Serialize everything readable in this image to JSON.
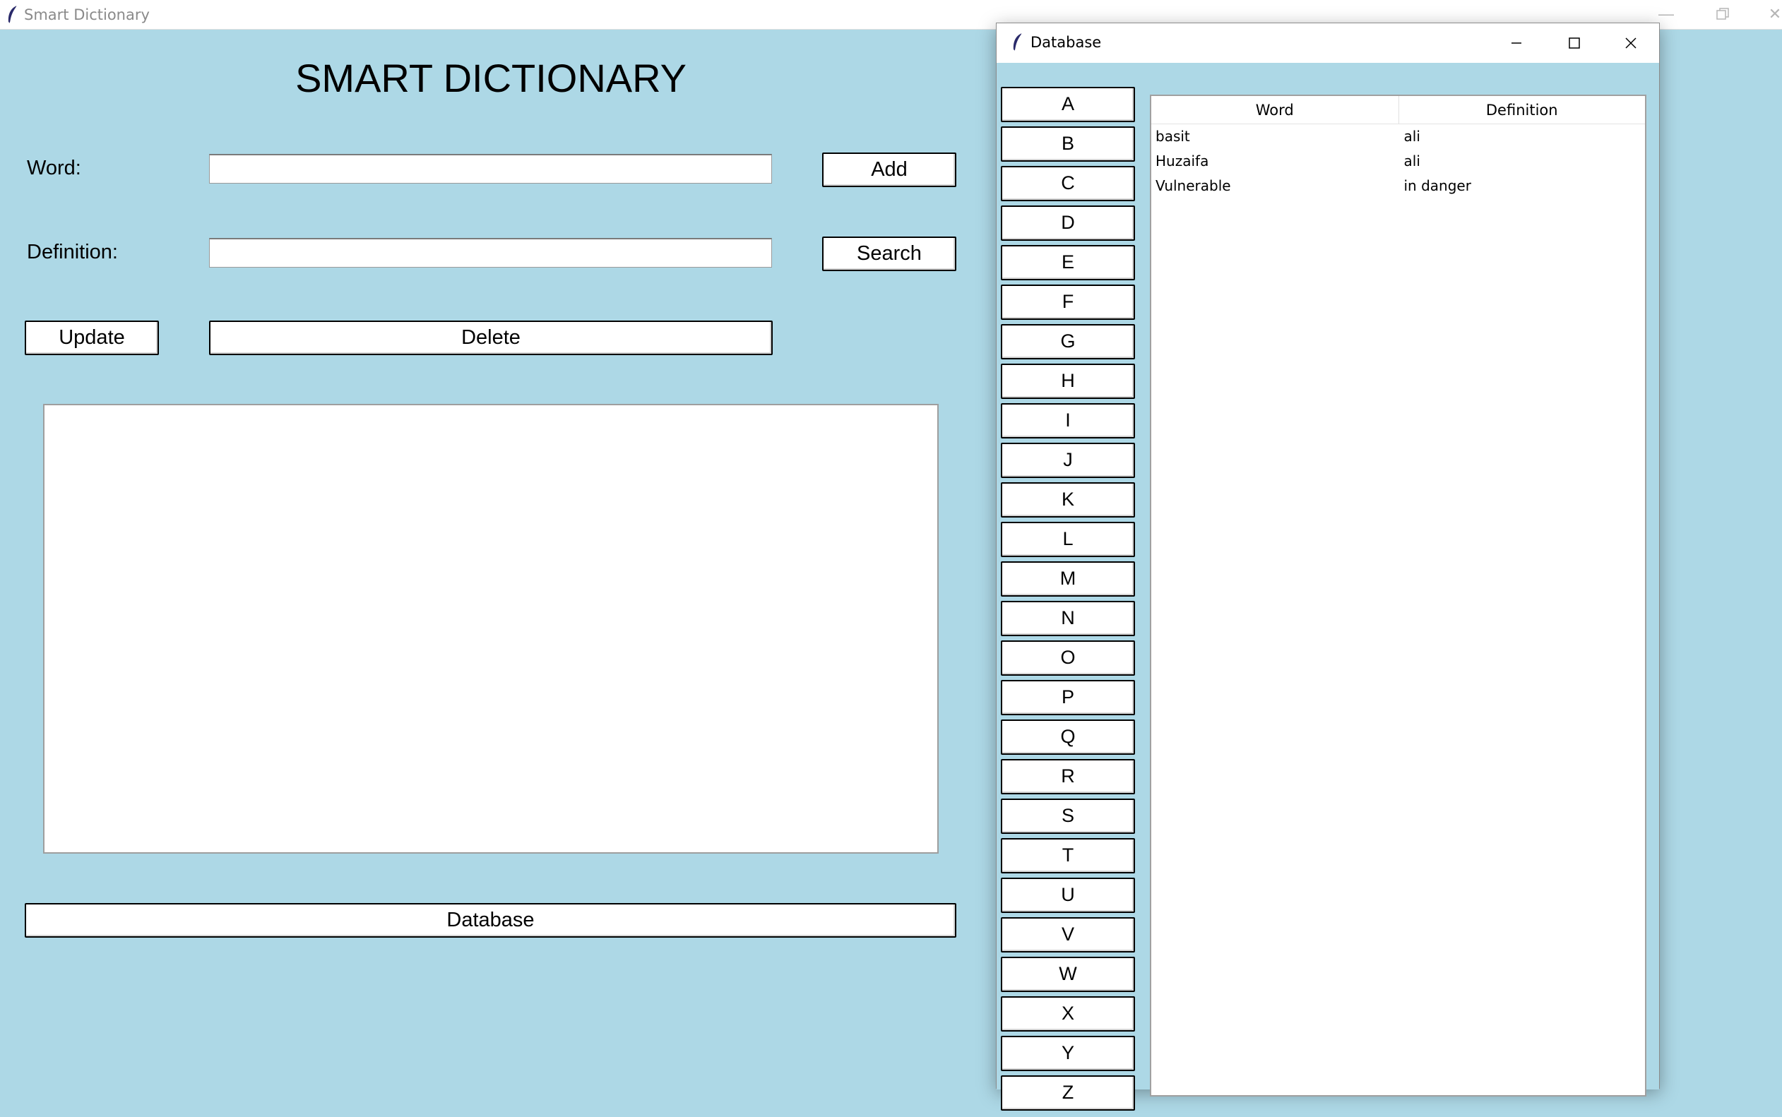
{
  "main_window": {
    "title": "Smart Dictionary",
    "heading": "SMART DICTIONARY",
    "word_label": "Word:",
    "word_value": "",
    "definition_label": "Definition:",
    "definition_value": "",
    "add_label": "Add",
    "search_label": "Search",
    "update_label": "Update",
    "delete_label": "Delete",
    "database_label": "Database",
    "background_color": "#add8e6"
  },
  "db_window": {
    "title": "Database",
    "letters": [
      "A",
      "B",
      "C",
      "D",
      "E",
      "F",
      "G",
      "H",
      "I",
      "J",
      "K",
      "L",
      "M",
      "N",
      "O",
      "P",
      "Q",
      "R",
      "S",
      "T",
      "U",
      "V",
      "W",
      "X",
      "Y",
      "Z"
    ],
    "columns": [
      "Word",
      "Definition"
    ],
    "rows": [
      {
        "word": "basit",
        "definition": "ali"
      },
      {
        "word": "Huzaifa",
        "definition": "ali"
      },
      {
        "word": "Vulnerable",
        "definition": "in danger"
      }
    ]
  },
  "icons": {
    "app_icon": "feather-icon",
    "minimize": "minimize-icon",
    "maximize": "maximize-icon",
    "restore": "restore-icon",
    "close": "close-icon"
  }
}
